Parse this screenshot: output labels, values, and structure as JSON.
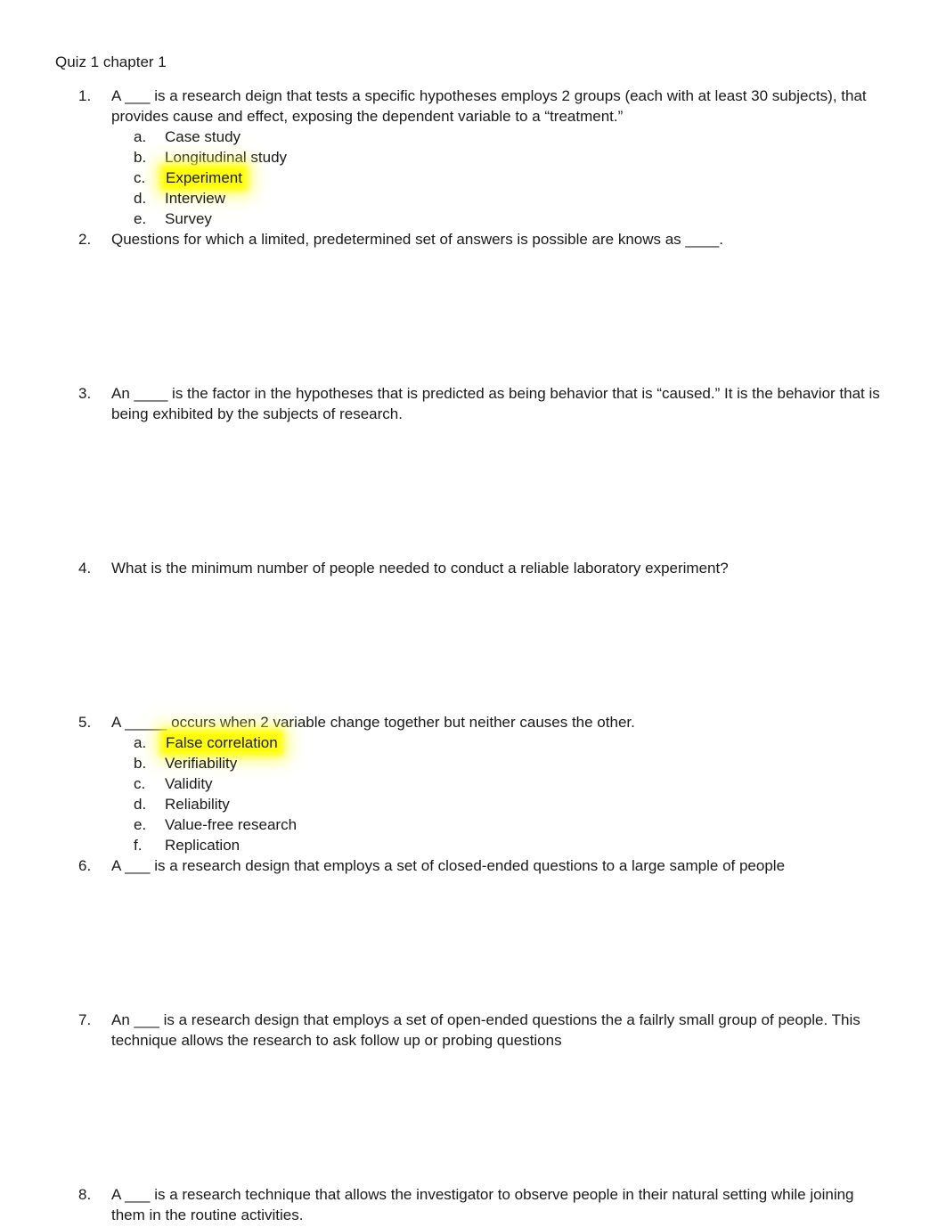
{
  "document": {
    "title": "Quiz 1 chapter 1"
  },
  "highlight_color": "#ffff00",
  "questions": [
    {
      "number": "1.",
      "text": "A ___ is a research deign that tests a specific hypotheses employs 2 groups (each with at least 30 subjects), that provides cause and effect, exposing the dependent variable to a “treatment.”",
      "options": [
        {
          "letter": "a.",
          "text": "Case study",
          "highlighted": false
        },
        {
          "letter": "b.",
          "text": "Longitudinal study",
          "highlighted": false
        },
        {
          "letter": "c.",
          "text": "Experiment",
          "highlighted": true
        },
        {
          "letter": "d.",
          "text": "Interview",
          "highlighted": false
        },
        {
          "letter": "e.",
          "text": "Survey",
          "highlighted": false
        }
      ],
      "answer_space": false
    },
    {
      "number": "2.",
      "text": "Questions for which a limited, predetermined set of answers is possible are knows as ____.",
      "options": [],
      "answer_space": true
    },
    {
      "number": "3.",
      "text": "An ____ is the factor in the hypotheses that is predicted as being behavior that is “caused.” It is the behavior that is being exhibited by the subjects of research.",
      "options": [],
      "answer_space": true
    },
    {
      "number": "4.",
      "text": "What is the minimum number of people needed to conduct a reliable laboratory experiment?",
      "options": [],
      "answer_space": true
    },
    {
      "number": "5.",
      "text": "A _____ occurs when 2 variable change together but neither causes the other.",
      "options": [
        {
          "letter": "a.",
          "text": "False correlation",
          "highlighted": true
        },
        {
          "letter": "b.",
          "text": "Verifiability",
          "highlighted": false
        },
        {
          "letter": "c.",
          "text": "Validity",
          "highlighted": false
        },
        {
          "letter": "d.",
          "text": "Reliability",
          "highlighted": false
        },
        {
          "letter": "e.",
          "text": "Value-free research",
          "highlighted": false
        },
        {
          "letter": "f.",
          "text": "Replication",
          "highlighted": false
        }
      ],
      "answer_space": false
    },
    {
      "number": "6.",
      "text": "A ___ is a research design that employs a set of closed-ended questions to a large sample of people",
      "options": [],
      "answer_space": true
    },
    {
      "number": "7.",
      "text": "An ___ is a research design that employs a set of open-ended questions the a failrly small group of people. This technique allows the research to ask follow up or probing questions",
      "options": [],
      "answer_space": true
    },
    {
      "number": "8.",
      "text": "A ___ is a research technique that allows the investigator to observe people in their natural setting while joining them in the routine activities.",
      "options": [],
      "answer_space": false
    }
  ]
}
